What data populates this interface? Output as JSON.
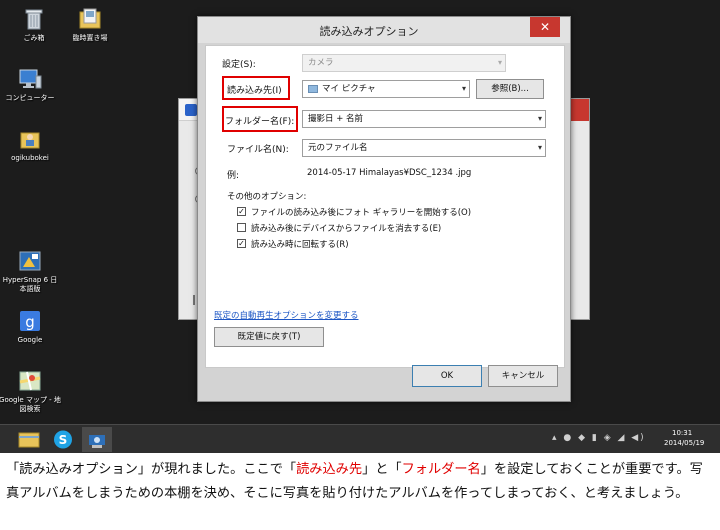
{
  "desktop_icons": [
    {
      "label": "ごみ箱",
      "icon": "recycle-bin-icon"
    },
    {
      "label": "臨時置き場",
      "icon": "folder-icon"
    },
    {
      "label": "コンピューター",
      "icon": "computer-icon"
    },
    {
      "label": "ogikubokei",
      "icon": "user-folder-icon"
    },
    {
      "label": "HyperSnap 6 日\n本語版",
      "icon": "hypersnap-icon"
    },
    {
      "label": "Google",
      "icon": "google-icon"
    },
    {
      "label": "Google マップ - 地\n図検索",
      "icon": "google-maps-icon"
    }
  ],
  "dialog": {
    "title": "読み込みオプション",
    "close_glyph": "✕",
    "settings_label": "設定(S):",
    "settings_value": "カメラ",
    "import_to_label": "読み込み先(I)",
    "import_to_value": "マイ ピクチャ",
    "browse_label": "参照(B)...",
    "folder_name_label": "フォルダー名(F):",
    "folder_name_value": "撮影日 + 名前",
    "file_name_label": "ファイル名(N):",
    "file_name_value": "元のファイル名",
    "example_label": "例:",
    "example_value": "2014-05-17 Himalayas¥DSC_1234 .jpg",
    "other_options_label": "その他のオプション:",
    "options": [
      {
        "label": "ファイルの読み込み後にフォト ギャラリーを開始する(O)",
        "checked": true
      },
      {
        "label": "読み込み後にデバイスからファイルを消去する(E)",
        "checked": false
      },
      {
        "label": "読み込み時に回転する(R)",
        "checked": true
      }
    ],
    "autoplay_link": "既定の自動再生オプションを変更する",
    "restore_defaults_label": "既定値に戻す(T)",
    "ok_label": "OK",
    "cancel_label": "キャンセル",
    "highlight_color": "#e00000"
  },
  "taskbar": {
    "clock_time": "10:31",
    "clock_date": "2014/05/19"
  },
  "caption": {
    "p1": "「読み込みオプション」が現れました。ここで「",
    "h1": "読み込み先",
    "p2": "」と「",
    "h2": "フォルダー名",
    "p3": "」を設定しておくことが重要です。写真アルバムをしまうための本棚を決め、そこに写真を貼り付けたアルバムを作ってしまっておく、と考えましょう。"
  }
}
